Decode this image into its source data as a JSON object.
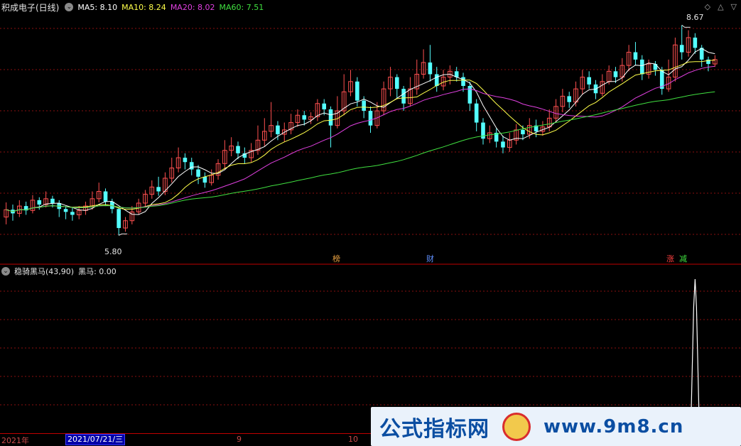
{
  "header": {
    "stock_name": "积成电子(日线)",
    "ma": [
      {
        "label": "MA5: 8.10",
        "color": "#ffffff"
      },
      {
        "label": "MA10: 8.24",
        "color": "#ffff4a"
      },
      {
        "label": "MA20: 8.02",
        "color": "#e040e0"
      },
      {
        "label": "MA60: 7.51",
        "color": "#40e040"
      }
    ]
  },
  "indicator": {
    "name": "稳骑黑马(43,90)",
    "value_label": "黑马: 0.00"
  },
  "extremes": {
    "high": "8.67",
    "low": "5.80"
  },
  "tags": [
    {
      "text": "榜",
      "color": "#e8a040"
    },
    {
      "text": "财",
      "color": "#6090ff"
    },
    {
      "text": "涨",
      "color": "#ff4040"
    },
    {
      "text": "减",
      "color": "#40e040"
    }
  ],
  "axis": {
    "year_label": "2021年",
    "selected_date": "2021/07/21/三",
    "months": [
      "9",
      "10"
    ]
  },
  "watermark": {
    "left": "公式指标网",
    "right": "www.9m8.cn"
  },
  "colors": {
    "up": "#ff5050",
    "down": "#54ffff",
    "grid": "#8a1010",
    "ma5": "#ffffff",
    "ma10": "#ffff4a",
    "ma20": "#e040e0",
    "ma60": "#40e040"
  },
  "chart_data": {
    "type": "candlestick",
    "price_range": [
      5.6,
      8.8
    ],
    "candles": [
      [
        6.05,
        6.15,
        6.25,
        5.95
      ],
      [
        6.15,
        6.1,
        6.22,
        6.0
      ],
      [
        6.1,
        6.2,
        6.28,
        6.05
      ],
      [
        6.2,
        6.14,
        6.26,
        6.08
      ],
      [
        6.14,
        6.28,
        6.35,
        6.1
      ],
      [
        6.28,
        6.22,
        6.32,
        6.15
      ],
      [
        6.22,
        6.3,
        6.4,
        6.18
      ],
      [
        6.3,
        6.24,
        6.34,
        6.18
      ],
      [
        6.24,
        6.16,
        6.28,
        6.05
      ],
      [
        6.16,
        6.12,
        6.2,
        6.02
      ],
      [
        6.12,
        6.08,
        6.18,
        6.0
      ],
      [
        6.08,
        6.14,
        6.2,
        6.02
      ],
      [
        6.14,
        6.2,
        6.26,
        6.08
      ],
      [
        6.2,
        6.3,
        6.4,
        6.15
      ],
      [
        6.3,
        6.4,
        6.52,
        6.25
      ],
      [
        6.4,
        6.26,
        6.44,
        6.2
      ],
      [
        6.26,
        6.16,
        6.3,
        6.1
      ],
      [
        6.16,
        5.9,
        6.18,
        5.8
      ],
      [
        5.9,
        6.0,
        6.05,
        5.85
      ],
      [
        6.0,
        6.12,
        6.2,
        5.95
      ],
      [
        6.12,
        6.24,
        6.3,
        6.08
      ],
      [
        6.24,
        6.36,
        6.42,
        6.18
      ],
      [
        6.36,
        6.46,
        6.55,
        6.3
      ],
      [
        6.46,
        6.4,
        6.6,
        6.34
      ],
      [
        6.4,
        6.58,
        6.66,
        6.35
      ],
      [
        6.58,
        6.72,
        6.86,
        6.52
      ],
      [
        6.72,
        6.86,
        7.0,
        6.66
      ],
      [
        6.86,
        6.8,
        6.92,
        6.7
      ],
      [
        6.8,
        6.7,
        6.86,
        6.62
      ],
      [
        6.7,
        6.6,
        6.76,
        6.5
      ],
      [
        6.6,
        6.52,
        6.66,
        6.45
      ],
      [
        6.52,
        6.62,
        6.7,
        6.48
      ],
      [
        6.62,
        6.78,
        6.84,
        6.56
      ],
      [
        6.78,
        6.96,
        7.1,
        6.7
      ],
      [
        6.96,
        7.02,
        7.14,
        6.88
      ],
      [
        7.02,
        6.92,
        7.08,
        6.84
      ],
      [
        6.92,
        6.86,
        7.0,
        6.78
      ],
      [
        6.86,
        6.96,
        7.06,
        6.8
      ],
      [
        6.96,
        7.1,
        7.3,
        6.9
      ],
      [
        7.1,
        7.22,
        7.4,
        7.02
      ],
      [
        7.22,
        7.3,
        7.62,
        7.14
      ],
      [
        7.3,
        7.18,
        7.36,
        7.1
      ],
      [
        7.18,
        7.24,
        7.34,
        7.08
      ],
      [
        7.24,
        7.34,
        7.46,
        7.18
      ],
      [
        7.34,
        7.44,
        7.52,
        7.28
      ],
      [
        7.44,
        7.38,
        7.5,
        7.3
      ],
      [
        7.38,
        7.42,
        7.48,
        7.32
      ],
      [
        7.42,
        7.6,
        7.66,
        7.36
      ],
      [
        7.6,
        7.52,
        7.66,
        7.44
      ],
      [
        7.52,
        7.3,
        7.56,
        7.0
      ],
      [
        7.3,
        7.5,
        7.7,
        7.26
      ],
      [
        7.5,
        7.76,
        8.0,
        7.44
      ],
      [
        7.76,
        7.9,
        8.06,
        7.7
      ],
      [
        7.9,
        7.64,
        7.96,
        7.56
      ],
      [
        7.64,
        7.5,
        7.7,
        7.4
      ],
      [
        7.5,
        7.3,
        7.56,
        7.2
      ],
      [
        7.3,
        7.5,
        7.62,
        7.26
      ],
      [
        7.5,
        7.8,
        7.9,
        7.44
      ],
      [
        7.8,
        7.96,
        8.1,
        7.7
      ],
      [
        7.96,
        7.8,
        8.0,
        7.66
      ],
      [
        7.8,
        7.6,
        7.84,
        7.5
      ],
      [
        7.6,
        7.8,
        7.96,
        7.56
      ],
      [
        7.8,
        8.0,
        8.2,
        7.72
      ],
      [
        8.0,
        8.16,
        8.34,
        7.94
      ],
      [
        8.16,
        8.0,
        8.4,
        7.9
      ],
      [
        8.0,
        7.84,
        8.1,
        7.76
      ],
      [
        7.84,
        7.96,
        8.06,
        7.78
      ],
      [
        7.96,
        8.04,
        8.12,
        7.86
      ],
      [
        8.04,
        7.96,
        8.1,
        7.9
      ],
      [
        7.96,
        7.84,
        8.02,
        7.76
      ],
      [
        7.84,
        7.6,
        7.9,
        7.5
      ],
      [
        7.6,
        7.34,
        7.66,
        7.22
      ],
      [
        7.34,
        7.12,
        7.4,
        7.04
      ],
      [
        7.12,
        7.2,
        7.3,
        7.06
      ],
      [
        7.2,
        7.08,
        7.26,
        7.0
      ],
      [
        7.08,
        7.0,
        7.16,
        6.92
      ],
      [
        7.0,
        7.1,
        7.2,
        6.94
      ],
      [
        7.1,
        7.24,
        7.32,
        7.04
      ],
      [
        7.24,
        7.18,
        7.3,
        7.1
      ],
      [
        7.18,
        7.3,
        7.4,
        7.12
      ],
      [
        7.3,
        7.22,
        7.38,
        7.14
      ],
      [
        7.22,
        7.28,
        7.36,
        7.16
      ],
      [
        7.28,
        7.4,
        7.52,
        7.22
      ],
      [
        7.4,
        7.56,
        7.66,
        7.34
      ],
      [
        7.56,
        7.7,
        7.8,
        7.48
      ],
      [
        7.7,
        7.62,
        7.76,
        7.54
      ],
      [
        7.62,
        7.8,
        7.9,
        7.56
      ],
      [
        7.8,
        7.96,
        8.06,
        7.72
      ],
      [
        7.96,
        7.86,
        8.04,
        7.8
      ],
      [
        7.86,
        7.74,
        7.92,
        7.66
      ],
      [
        7.74,
        7.9,
        8.0,
        7.7
      ],
      [
        7.9,
        8.04,
        8.12,
        7.86
      ],
      [
        8.04,
        7.96,
        8.1,
        7.88
      ],
      [
        7.96,
        8.12,
        8.22,
        7.9
      ],
      [
        8.12,
        8.3,
        8.4,
        8.04
      ],
      [
        8.3,
        8.2,
        8.44,
        8.12
      ],
      [
        8.2,
        8.0,
        8.26,
        7.92
      ],
      [
        8.0,
        8.14,
        8.2,
        7.94
      ],
      [
        8.14,
        8.06,
        8.18,
        7.98
      ],
      [
        8.06,
        7.8,
        8.1,
        7.72
      ],
      [
        7.8,
        7.96,
        8.2,
        7.76
      ],
      [
        7.96,
        8.4,
        8.5,
        7.9
      ],
      [
        8.4,
        8.3,
        8.67,
        8.2
      ],
      [
        8.3,
        8.5,
        8.6,
        8.24
      ],
      [
        8.5,
        8.36,
        8.56,
        8.28
      ],
      [
        8.36,
        8.2,
        8.4,
        8.1
      ],
      [
        8.2,
        8.14,
        8.24,
        8.04
      ],
      [
        8.14,
        8.2,
        8.26,
        8.1
      ]
    ],
    "ma_periods": [
      5,
      10,
      20,
      60
    ],
    "indicator_series": {
      "name": "黑马",
      "values_zero_except_spike_at_index": 104,
      "spike_value": 1.0
    }
  }
}
